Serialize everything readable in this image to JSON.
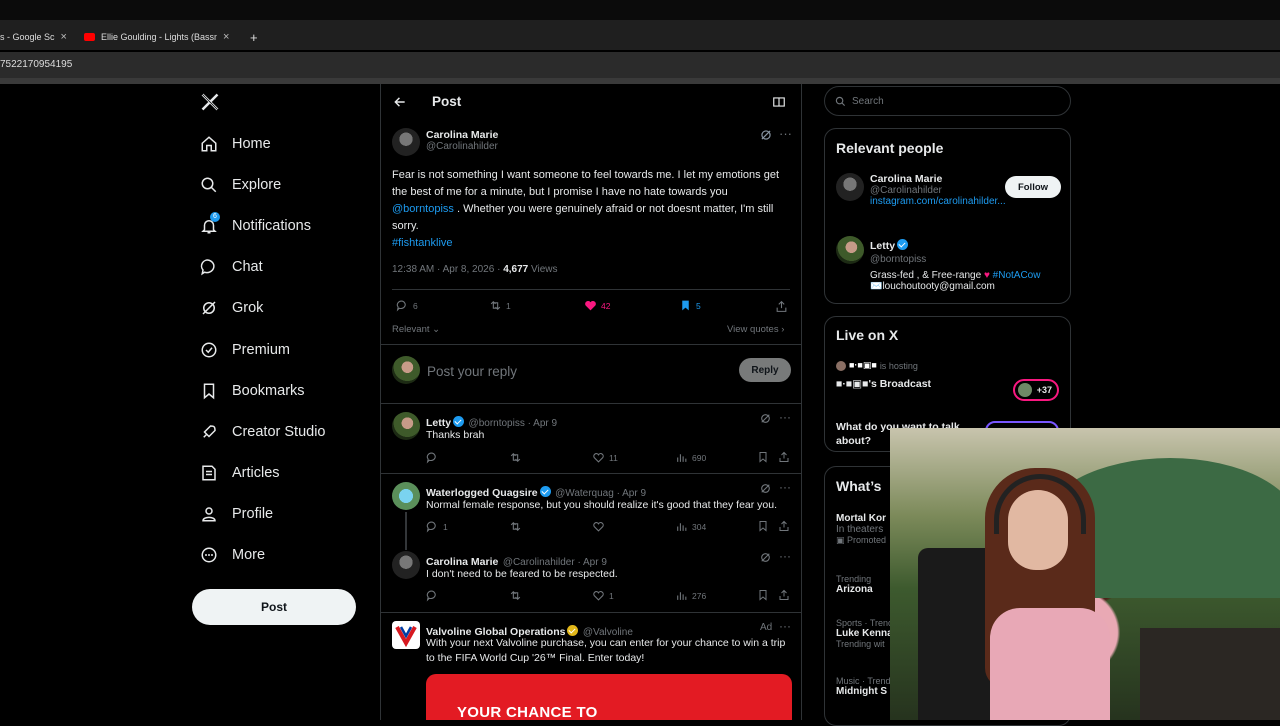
{
  "browser": {
    "tabs": [
      {
        "label": "s - Google Sc"
      },
      {
        "label": "Ellie Goulding - Lights (Bassnec"
      }
    ],
    "new_tab": "+",
    "url_fragment": "7522170954195"
  },
  "sidebar": {
    "logo": "X",
    "items": [
      {
        "label": "Home",
        "icon": "home-icon"
      },
      {
        "label": "Explore",
        "icon": "search-icon"
      },
      {
        "label": "Notifications",
        "icon": "bell-icon",
        "badge": "6"
      },
      {
        "label": "Chat",
        "icon": "chat-icon"
      },
      {
        "label": "Grok",
        "icon": "grok-icon"
      },
      {
        "label": "Premium",
        "icon": "premium-icon"
      },
      {
        "label": "Bookmarks",
        "icon": "bookmark-icon"
      },
      {
        "label": "Creator Studio",
        "icon": "rocket-icon"
      },
      {
        "label": "Articles",
        "icon": "articles-icon"
      },
      {
        "label": "Profile",
        "icon": "person-icon"
      },
      {
        "label": "More",
        "icon": "more-circle-icon"
      }
    ],
    "post_button": "Post"
  },
  "main": {
    "header_title": "Post",
    "tweet": {
      "name": "Carolina Marie",
      "handle": "@Carolinahilder",
      "text_before": "Fear is not something I want someone to feel towards me. I let my emotions get the best of me for a minute, but I promise I have no hate towards you ",
      "mention": "@borntopiss",
      "text_after": " . Whether you were genuinely afraid or not doesnt matter, I'm still sorry.",
      "hashtag": "#fishtanklive",
      "timestamp": "12:38 AM · Apr 8, 2026 · ",
      "views_count": "4,677",
      "views_label": " Views",
      "replies": "6",
      "reposts": "1",
      "likes": "42",
      "bookmarks": "5",
      "sort_label": "Relevant",
      "view_quotes": "View quotes"
    },
    "reply_box": {
      "placeholder": "Post your reply",
      "button": "Reply"
    },
    "replies": [
      {
        "name": "Letty",
        "handle": "@borntopiss · Apr 9",
        "text": "Thanks brah",
        "replies": "",
        "reposts": "",
        "likes": "11",
        "views": "690"
      },
      {
        "name": "Waterlogged Quagsire",
        "handle": "@Waterquag · Apr 9",
        "text": "Normal female response, but you should realize it's good that they fear you.",
        "replies": "1",
        "reposts": "",
        "likes": "",
        "views": "304"
      },
      {
        "name": "Carolina Marie",
        "handle": "@Carolinahilder · Apr 9",
        "text": "I don't need to be feared to be respected.",
        "replies": "",
        "reposts": "",
        "likes": "1",
        "views": "276"
      }
    ],
    "ad": {
      "name": "Valvoline Global Operations",
      "handle": "@Valvoline",
      "ad_label": "Ad",
      "text": "With your next Valvoline purchase, you can enter for your chance to win a trip to the FIFA World Cup '26™ Final. Enter today!",
      "banner": "YOUR CHANCE TO"
    }
  },
  "right": {
    "search_placeholder": "Search",
    "relevant_people": {
      "title": "Relevant people",
      "people": [
        {
          "name": "Carolina Marie",
          "handle": "@Carolinahilder",
          "link": "instagram.com/carolinahilder...",
          "follow": "Follow"
        },
        {
          "name": "Letty",
          "handle": "@borntopiss",
          "bio_1": "Grass-fed , & Free-range ",
          "bio_tag": "#NotACow",
          "bio_2": "✉️louchoutooty@gmail.com"
        }
      ]
    },
    "live": {
      "title": "Live on X",
      "hosting": "is hosting",
      "broadcast": "'s Broadcast",
      "listeners": "+37",
      "question": "What do you want to talk about?"
    },
    "whats": {
      "title": "What’s",
      "items": [
        {
          "top": "",
          "title": "Mortal Kor",
          "sub": "In theaters",
          "promo": "Promoted"
        },
        {
          "top": "Trending",
          "title": "Arizona",
          "sub": ""
        },
        {
          "top": "Sports · Trenc",
          "title": "Luke Kenna",
          "sub": "Trending wit"
        },
        {
          "top": "Music · Trend",
          "title": "Midnight S",
          "sub": ""
        }
      ]
    }
  },
  "colors": {
    "accent": "#1d9bf0",
    "like": "#f91880",
    "background": "#000000",
    "border": "#2f3336"
  }
}
